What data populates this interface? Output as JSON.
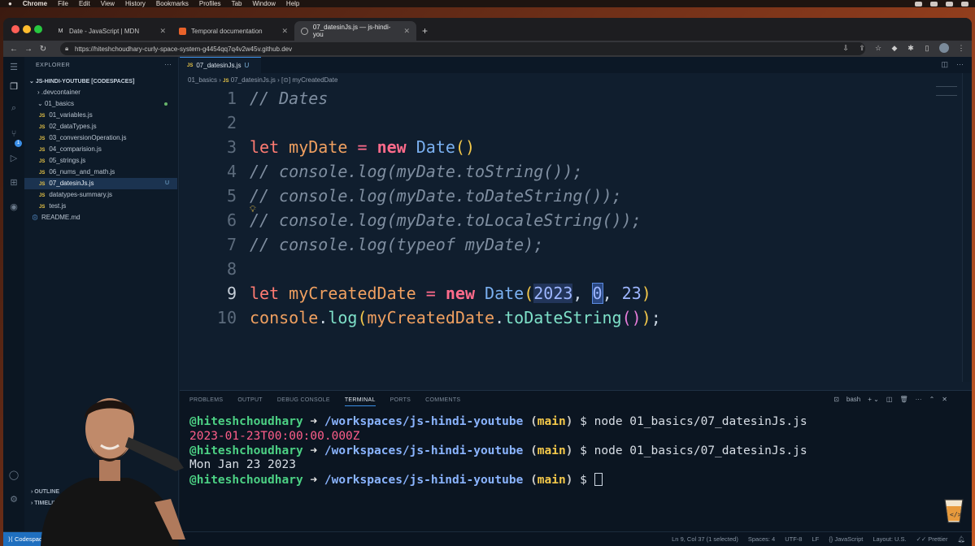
{
  "menubar": {
    "app": "Chrome",
    "items": [
      "File",
      "Edit",
      "View",
      "History",
      "Bookmarks",
      "Profiles",
      "Tab",
      "Window",
      "Help"
    ]
  },
  "browser": {
    "tabs": [
      {
        "label": "Date - JavaScript | MDN",
        "icon": "mdn-icon"
      },
      {
        "label": "Temporal documentation",
        "icon": "temporal-icon"
      },
      {
        "label": "07_datesinJs.js — js-hindi-you",
        "icon": "github-icon"
      }
    ],
    "url": "https://hiteshchoudhary-curly-space-system-g4454qq7q4v2w45v.github.dev"
  },
  "explorer": {
    "title": "EXPLORER",
    "root": "JS-HINDI-YOUTUBE [CODESPACES]",
    "items": [
      {
        "label": ".devcontainer",
        "type": "folder",
        "indent": 1
      },
      {
        "label": "01_basics",
        "type": "folder-open",
        "indent": 1
      },
      {
        "label": "01_variables.js",
        "type": "js",
        "indent": 2
      },
      {
        "label": "02_dataTypes.js",
        "type": "js",
        "indent": 2
      },
      {
        "label": "03_conversionOperation.js",
        "type": "js",
        "indent": 2
      },
      {
        "label": "04_comparision.js",
        "type": "js",
        "indent": 2
      },
      {
        "label": "05_strings.js",
        "type": "js",
        "indent": 2
      },
      {
        "label": "06_nums_and_math.js",
        "type": "js",
        "indent": 2
      },
      {
        "label": "07_datesinJs.js",
        "type": "js",
        "indent": 2,
        "status": "U"
      },
      {
        "label": "datatypes-summary.js",
        "type": "js",
        "indent": 2
      },
      {
        "label": "test.js",
        "type": "js",
        "indent": 2
      },
      {
        "label": "README.md",
        "type": "md",
        "indent": 1
      }
    ],
    "bottom": [
      "OUTLINE",
      "TIMELINE"
    ]
  },
  "editor": {
    "tab_label": "07_datesinJs.js",
    "tab_status": "U",
    "breadcrumb": [
      "01_basics",
      "07_datesinJs.js",
      "myCreatedDate"
    ],
    "line_numbers": [
      "1",
      "2",
      "3",
      "4",
      "5",
      "6",
      "7",
      "8",
      "9",
      "10"
    ],
    "lines": {
      "l1": "// Dates",
      "l3_kw": "let",
      "l3_var": "myDate",
      "l3_new": "new",
      "l3_cls": "Date",
      "l4": "// console.log(myDate.toString());",
      "l5": "// console.log(myDate.toDateString());",
      "l6": "// console.log(myDate.toLocaleString());",
      "l7": "// console.log(typeof myDate);",
      "l9_kw": "let",
      "l9_var": "myCreatedDate",
      "l9_new": "new",
      "l9_cls": "Date",
      "l9_a1": "2023",
      "l9_a2": "0",
      "l9_a3": "23",
      "l10_obj": "console",
      "l10_fn": "log",
      "l10_var": "myCreatedDate",
      "l10_m": "toDateString"
    }
  },
  "panel": {
    "tabs": [
      "PROBLEMS",
      "OUTPUT",
      "DEBUG CONSOLE",
      "TERMINAL",
      "PORTS",
      "COMMENTS"
    ],
    "active_tab": "TERMINAL",
    "shell": "bash",
    "terminal": [
      {
        "user": "@hiteshchoudhary",
        "path": "/workspaces/js-hindi-youtube",
        "branch": "main",
        "cmd": "node 01_basics/07_datesinJs.js"
      },
      {
        "output": "2023-01-23T00:00:00.000Z",
        "error": true
      },
      {
        "user": "@hiteshchoudhary",
        "path": "/workspaces/js-hindi-youtube",
        "branch": "main",
        "cmd": "node 01_basics/07_datesinJs.js"
      },
      {
        "output": "Mon Jan 23 2023",
        "error": false
      },
      {
        "user": "@hiteshchoudhary",
        "path": "/workspaces/js-hindi-youtube",
        "branch": "main",
        "cmd": ""
      }
    ]
  },
  "statusbar": {
    "remote": "Codespaces",
    "cursor": "Ln 9, Col 37 (1 selected)",
    "spaces": "Spaces: 4",
    "encoding": "UTF-8",
    "eol": "LF",
    "language": "JavaScript",
    "layout": "Layout: U.S.",
    "formatter": "Prettier"
  }
}
